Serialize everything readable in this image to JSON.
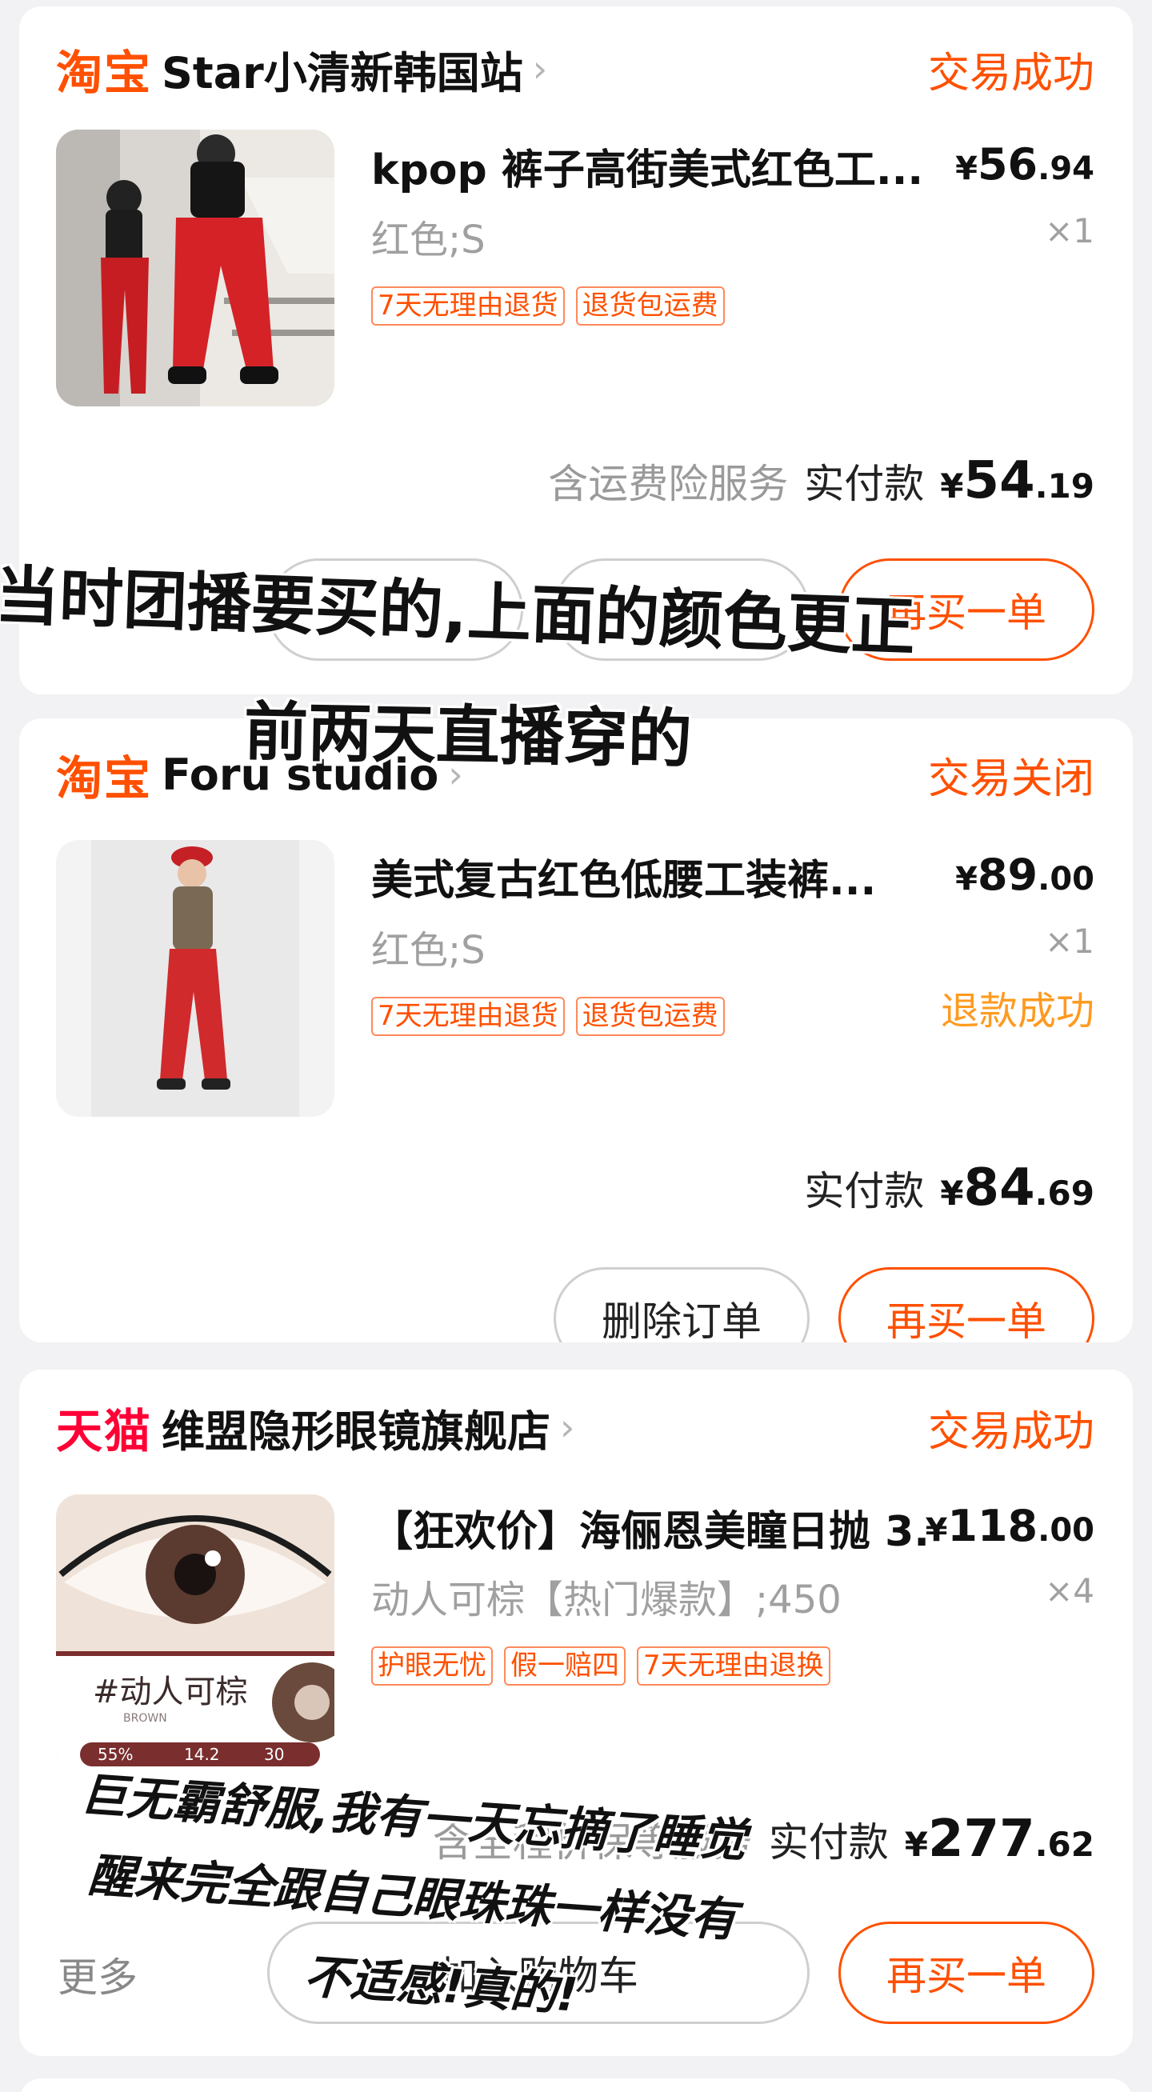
{
  "orders": [
    {
      "platform": "淘宝",
      "shop": "Star小清新韩国站",
      "status": "交易成功",
      "product_title": "kpop 裤子高街美式红色工...",
      "price_currency": "¥",
      "price_int": "56",
      "price_dec": ".94",
      "variant": "红色;S",
      "qty": "×1",
      "tags": [
        "7天无理由退货",
        "退货包运费"
      ],
      "service_note": "含运费险服务",
      "pay_label": "实付款",
      "pay_currency": "¥",
      "pay_int": "54",
      "pay_dec": ".19",
      "btn_left_1": "",
      "btn_left_2": "",
      "btn_primary": "再买一单"
    },
    {
      "platform": "淘宝",
      "shop": "Foru studio",
      "status": "交易关闭",
      "product_title": "美式复古红色低腰工装裤...",
      "price_currency": "¥",
      "price_int": "89",
      "price_dec": ".00",
      "variant": "红色;S",
      "qty": "×1",
      "tags": [
        "7天无理由退货",
        "退货包运费"
      ],
      "refund_status": "退款成功",
      "pay_label": "实付款",
      "pay_currency": "¥",
      "pay_int": "84",
      "pay_dec": ".69",
      "btn_delete": "删除订单",
      "btn_primary": "再买一单"
    },
    {
      "platform": "天猫",
      "shop": "维盟隐形眼镜旗舰店",
      "status": "交易成功",
      "product_title": "【狂欢价】海俪恩美瞳日抛 3...",
      "price_currency": "¥",
      "price_int": "118",
      "price_dec": ".00",
      "variant": "动人可棕【热门爆款】;450",
      "qty": "×4",
      "tags": [
        "护眼无忧",
        "假一赔四",
        "7天无理由退换"
      ],
      "service_note": "含全程价保等服务",
      "pay_label": "实付款",
      "pay_currency": "¥",
      "pay_int": "277",
      "pay_dec": ".62",
      "more": "更多",
      "btn_cart": "加入购物车",
      "btn_primary": "再买一单",
      "lens_label": "#动人可棕",
      "lens_sub": "BROWN",
      "lens_specs": [
        "55%",
        "14.2",
        "30"
      ]
    }
  ],
  "captions": {
    "c1_line1": "当时团播要买的,上面的颜色更正",
    "c1_line2": "前两天直播穿的",
    "c2_line1": "巨无霸舒服,我有一天忘摘了睡觉",
    "c2_line2": "醒来完全跟自己眼珠珠一样没有",
    "c2_line3": "不适感!真的!"
  },
  "colors": {
    "accent": "#ff5000",
    "tmall": "#ff0036",
    "refund": "#ff9a1f"
  }
}
